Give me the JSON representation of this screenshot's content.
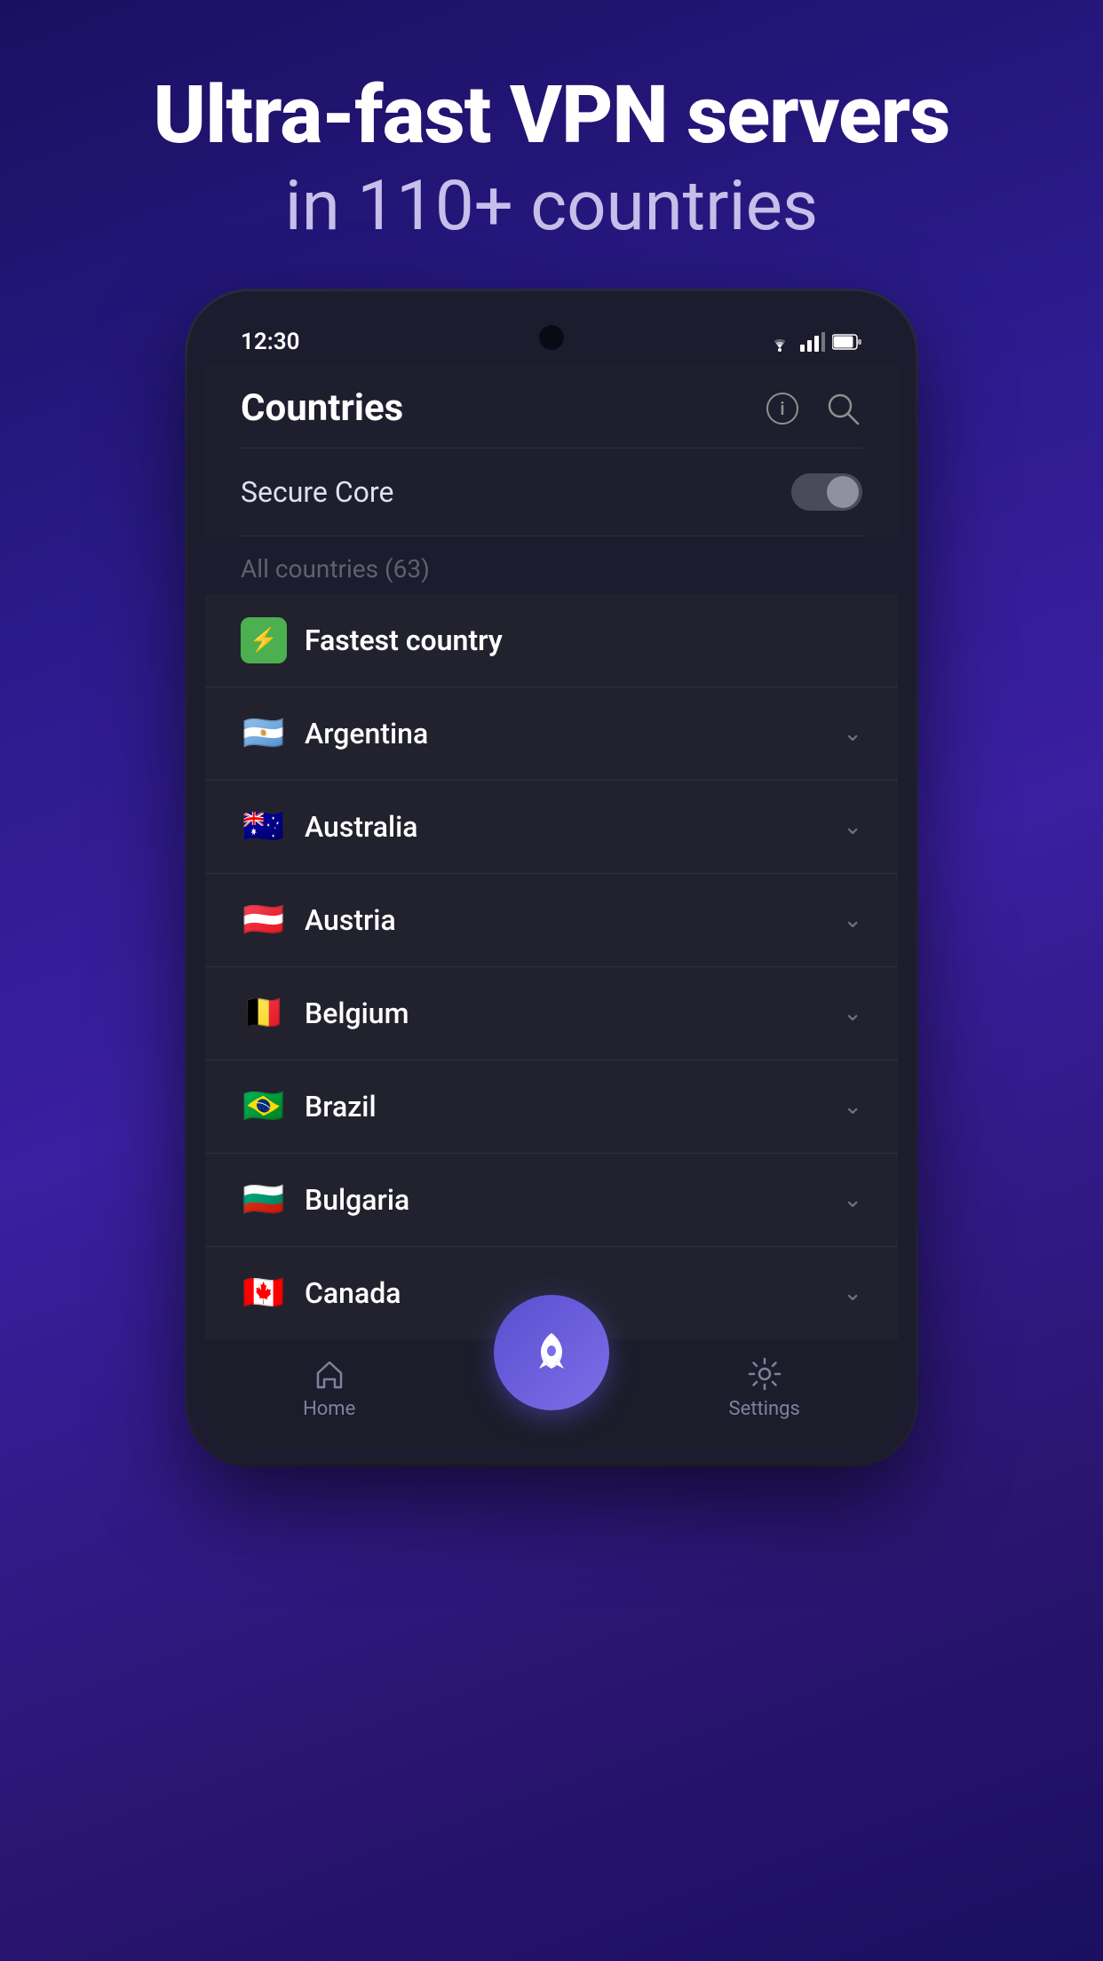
{
  "hero": {
    "title": "Ultra-fast VPN servers",
    "subtitle": "in 110+ countries"
  },
  "statusBar": {
    "time": "12:30",
    "icons": [
      "wifi",
      "signal",
      "battery"
    ]
  },
  "header": {
    "title": "Countries",
    "infoLabel": "info",
    "searchLabel": "search"
  },
  "secureCore": {
    "label": "Secure Core",
    "toggleOn": false
  },
  "allCountries": {
    "label": "All countries (63)"
  },
  "fastestCountry": {
    "label": "Fastest country"
  },
  "countries": [
    {
      "name": "Argentina",
      "flag": "🇦🇷"
    },
    {
      "name": "Australia",
      "flag": "🇦🇺"
    },
    {
      "name": "Austria",
      "flag": "🇦🇹"
    },
    {
      "name": "Belgium",
      "flag": "🇧🇪"
    },
    {
      "name": "Brazil",
      "flag": "🇧🇷"
    },
    {
      "name": "Bulgaria",
      "flag": "🇧🇬"
    },
    {
      "name": "Canada",
      "flag": "🇨🇦"
    }
  ],
  "bottomNav": {
    "homeLabel": "Home",
    "settingsLabel": "Settings"
  }
}
